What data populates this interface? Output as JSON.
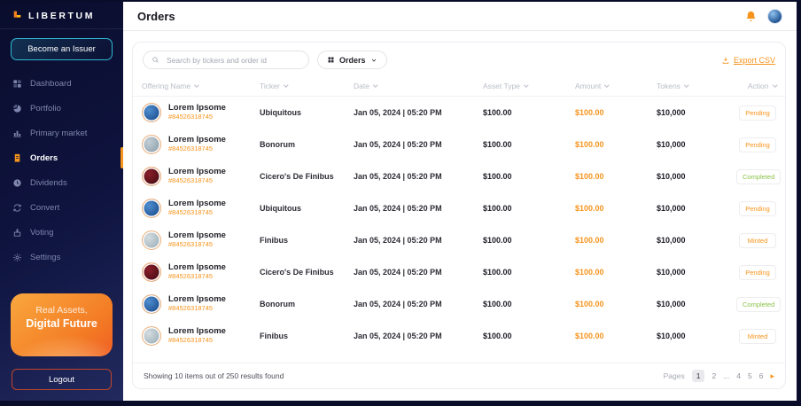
{
  "brand": {
    "name": "LIBERTUM",
    "logo_icon": "libertum-logo-icon"
  },
  "sidebar": {
    "issuer_button": "Become an Issuer",
    "items": [
      {
        "label": "Dashboard",
        "icon": "dashboard-icon",
        "active": false
      },
      {
        "label": "Portfolio",
        "icon": "portfolio-pie-icon",
        "active": false
      },
      {
        "label": "Primary market",
        "icon": "bar-chart-icon",
        "active": false
      },
      {
        "label": "Orders",
        "icon": "orders-receipt-icon",
        "active": true
      },
      {
        "label": "Dividends",
        "icon": "dividends-clock-icon",
        "active": false
      },
      {
        "label": "Convert",
        "icon": "convert-arrows-icon",
        "active": false
      },
      {
        "label": "Voting",
        "icon": "voting-ballot-icon",
        "active": false
      },
      {
        "label": "Settings",
        "icon": "gear-icon",
        "active": false
      }
    ],
    "promo": {
      "line1": "Real Assets,",
      "line2": "Digital Future"
    },
    "logout_label": "Logout"
  },
  "header": {
    "title": "Orders",
    "icons": [
      "bell-icon",
      "user-avatar"
    ]
  },
  "toolbar": {
    "search_placeholder": "Search by tickers and order id",
    "search_value": "",
    "filter_label": "Orders",
    "export_label": "Export CSV"
  },
  "table": {
    "columns": [
      "Offering Name",
      "Ticker",
      "Date",
      "Asset Type",
      "Amount",
      "Tokens",
      "Action"
    ],
    "rows": [
      {
        "offering_name": "Lorem Ipsome",
        "order_id": "#84526318745",
        "ticker": "Ubiquitous",
        "date": "Jan 05, 2024 | 05:20 PM",
        "asset_type": "$100.00",
        "amount": "$100.00",
        "tokens": "$10,000",
        "action": "Pending",
        "avatar": "blue"
      },
      {
        "offering_name": "Lorem Ipsome",
        "order_id": "#84526318745",
        "ticker": "Bonorum",
        "date": "Jan 05, 2024 | 05:20 PM",
        "asset_type": "$100.00",
        "amount": "$100.00",
        "tokens": "$10,000",
        "action": "Pending",
        "avatar": "gray"
      },
      {
        "offering_name": "Lorem Ipsome",
        "order_id": "#84526318745",
        "ticker": "Cicero's De Finibus",
        "date": "Jan 05, 2024 | 05:20 PM",
        "asset_type": "$100.00",
        "amount": "$100.00",
        "tokens": "$10,000",
        "action": "Completed",
        "avatar": "red"
      },
      {
        "offering_name": "Lorem Ipsome",
        "order_id": "#84526318745",
        "ticker": "Ubiquitous",
        "date": "Jan 05, 2024 | 05:20 PM",
        "asset_type": "$100.00",
        "amount": "$100.00",
        "tokens": "$10,000",
        "action": "Pending",
        "avatar": "blue"
      },
      {
        "offering_name": "Lorem Ipsome",
        "order_id": "#84526318745",
        "ticker": "Finibus",
        "date": "Jan 05, 2024 | 05:20 PM",
        "asset_type": "$100.00",
        "amount": "$100.00",
        "tokens": "$10,000",
        "action": "Minted",
        "avatar": "light"
      },
      {
        "offering_name": "Lorem Ipsome",
        "order_id": "#84526318745",
        "ticker": "Cicero's De Finibus",
        "date": "Jan 05, 2024 | 05:20 PM",
        "asset_type": "$100.00",
        "amount": "$100.00",
        "tokens": "$10,000",
        "action": "Pending",
        "avatar": "red"
      },
      {
        "offering_name": "Lorem Ipsome",
        "order_id": "#84526318745",
        "ticker": "Bonorum",
        "date": "Jan 05, 2024 | 05:20 PM",
        "asset_type": "$100.00",
        "amount": "$100.00",
        "tokens": "$10,000",
        "action": "Completed",
        "avatar": "blue"
      },
      {
        "offering_name": "Lorem Ipsome",
        "order_id": "#84526318745",
        "ticker": "Finibus",
        "date": "Jan 05, 2024 | 05:20 PM",
        "asset_type": "$100.00",
        "amount": "$100.00",
        "tokens": "$10,000",
        "action": "Minted",
        "avatar": "light"
      }
    ],
    "status_colors": {
      "Pending": "#F7941D",
      "Completed": "#8BC34A",
      "Minted": "#F7941D"
    }
  },
  "footer": {
    "summary": "Showing 10 items out of 250 results found",
    "pages_label": "Pages",
    "pages": [
      "1",
      "2",
      "...",
      "4",
      "5",
      "6"
    ],
    "active_page": "1",
    "next_icon": "▸"
  },
  "colors": {
    "accent": "#F7941D",
    "success": "#8BC34A",
    "sidebar_bg": "#0B0E30",
    "issuer_border": "#2FB9D4",
    "logout_border": "#C0452C"
  }
}
